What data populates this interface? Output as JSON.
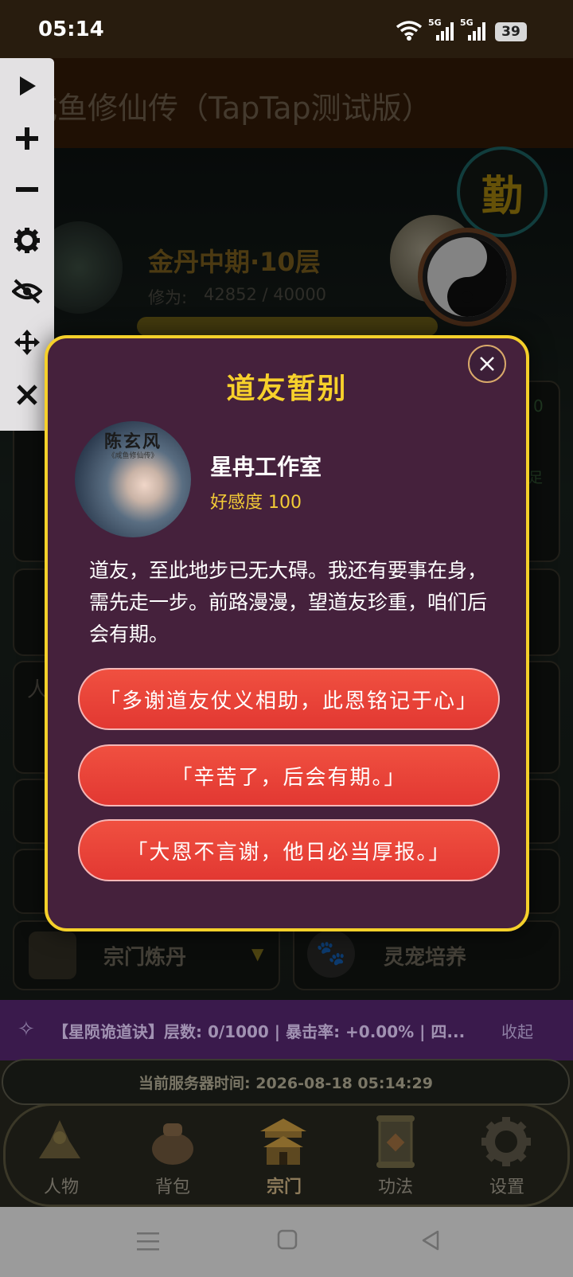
{
  "status": {
    "time": "05:14",
    "net1": "5G",
    "net2": "5G",
    "battery": "39"
  },
  "app": {
    "title": "咸鱼修仙传（TapTap测试版）"
  },
  "profile": {
    "realm": "金丹中期·10层",
    "cultivation_label": "修为:",
    "cultivation_value": "42852 / 40000",
    "diligence_badge": "勤"
  },
  "bg": {
    "card_partial": "人",
    "right_a": "0",
    "right_b": "足"
  },
  "buttons": {
    "alchemy": "宗门炼丹",
    "pet": "灵宠培养"
  },
  "dialog": {
    "title": "道友暂别",
    "avatar_caption": "陈玄风",
    "avatar_sub": "《咸鱼修仙传》",
    "npc_name": "星冉工作室",
    "affinity": "好感度 100",
    "message": "道友，至此地步已无大碍。我还有要事在身，需先走一步。前路漫漫，望道友珍重，咱们后会有期。",
    "options": [
      "「多谢道友仗义相助，此恩铭记于心」",
      "「辛苦了，后会有期。」",
      "「大恩不言谢，他日必当厚报。」"
    ]
  },
  "ticker": {
    "text": "【星陨诡道诀】层数: 0/1000 | 暴击率: +0.00% | 四...",
    "collapse": "收起"
  },
  "server": {
    "text": "当前服务器时间: 2026-08-18 05:14:29"
  },
  "nav": [
    {
      "label": "人物"
    },
    {
      "label": "背包"
    },
    {
      "label": "宗门"
    },
    {
      "label": "功法"
    },
    {
      "label": "设置"
    }
  ],
  "colors": {
    "gold": "#f5d02a",
    "dialog_bg": "#45213c",
    "option_red": "#e63c34",
    "ticker_bg": "#3a1a4c"
  }
}
